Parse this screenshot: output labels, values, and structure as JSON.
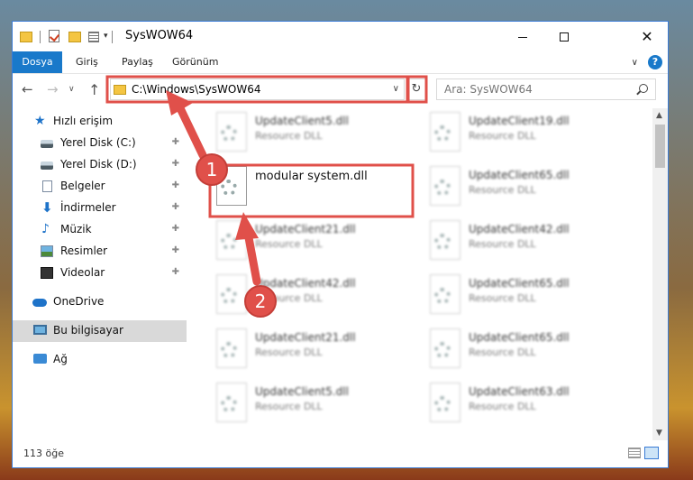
{
  "window": {
    "title": "SysWOW64",
    "minimize": "—",
    "maximize": "",
    "close": "✕"
  },
  "quick_access_toolbar": {
    "dropdown": "▾"
  },
  "ribbon": {
    "tabs": [
      "Dosya",
      "Giriş",
      "Paylaş",
      "Görünüm"
    ],
    "expand": "∨",
    "help": "?"
  },
  "nav": {
    "back": "←",
    "forward": "→",
    "recent": "∨",
    "up": "↑",
    "address": "C:\\Windows\\SysWOW64",
    "address_dropdown": "∨",
    "refresh": "↻",
    "search_placeholder": "Ara: SysWOW64"
  },
  "sidebar": {
    "items": [
      {
        "label": "Hızlı erişim",
        "icon": "star-icon",
        "pinned": false
      },
      {
        "label": "Yerel Disk (C:)",
        "icon": "drive-icon",
        "pinned": true
      },
      {
        "label": "Yerel Disk (D:)",
        "icon": "drive-icon",
        "pinned": true
      },
      {
        "label": "Belgeler",
        "icon": "document-icon",
        "pinned": true
      },
      {
        "label": "İndirmeler",
        "icon": "download-icon",
        "pinned": true
      },
      {
        "label": "Müzik",
        "icon": "music-icon",
        "pinned": true
      },
      {
        "label": "Resimler",
        "icon": "pictures-icon",
        "pinned": true
      },
      {
        "label": "Videolar",
        "icon": "video-icon",
        "pinned": true
      },
      {
        "label": "OneDrive",
        "icon": "onedrive-icon",
        "pinned": false
      },
      {
        "label": "Bu bilgisayar",
        "icon": "computer-icon",
        "pinned": false,
        "selected": true
      },
      {
        "label": "Ağ",
        "icon": "network-icon",
        "pinned": false
      }
    ],
    "pin_glyph": "📌"
  },
  "files": {
    "left": [
      {
        "name": "UpdateClient5.dll",
        "type": "Resource DLL"
      },
      {
        "name": "modular system.dll",
        "type": "",
        "highlighted": true
      },
      {
        "name": "UpdateClient21.dll",
        "type": "Resource DLL"
      },
      {
        "name": "UpdateClient42.dll",
        "type": "Resource DLL"
      },
      {
        "name": "UpdateClient21.dll",
        "type": "Resource DLL"
      },
      {
        "name": "UpdateClient5.dll",
        "type": "Resource DLL"
      }
    ],
    "right": [
      {
        "name": "UpdateClient19.dll",
        "type": "Resource DLL"
      },
      {
        "name": "UpdateClient65.dll",
        "type": "Resource DLL"
      },
      {
        "name": "UpdateClient42.dll",
        "type": "Resource DLL"
      },
      {
        "name": "UpdateClient65.dll",
        "type": "Resource DLL"
      },
      {
        "name": "UpdateClient65.dll",
        "type": "Resource DLL"
      },
      {
        "name": "UpdateClient63.dll",
        "type": "Resource DLL"
      }
    ]
  },
  "scrollbar": {
    "up": "▲",
    "down": "▼"
  },
  "status": {
    "item_count": "113 öğe"
  },
  "annotations": {
    "badge_1": "1",
    "badge_2": "2",
    "color": "#e0504a"
  }
}
